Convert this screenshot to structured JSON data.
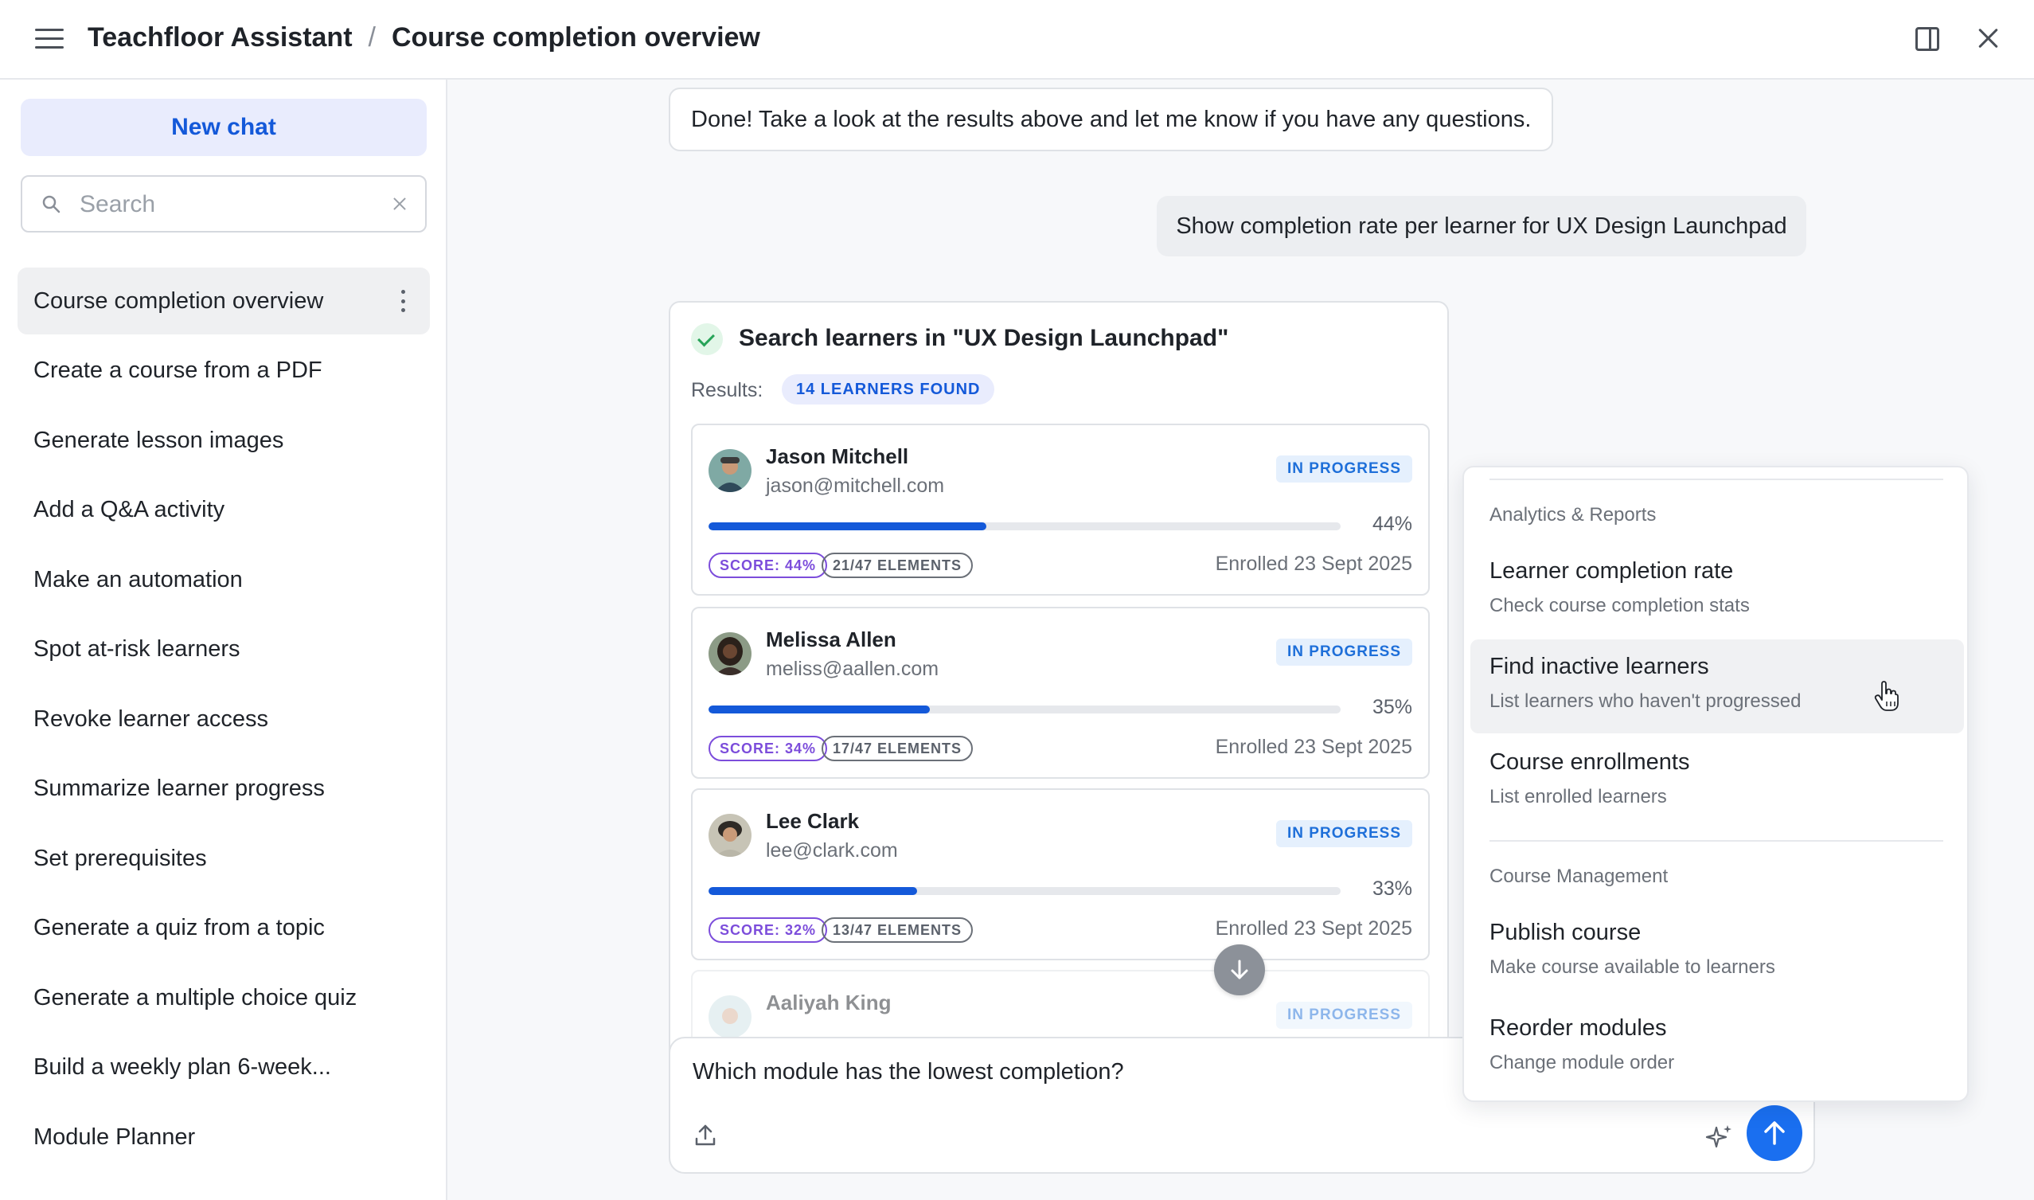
{
  "header": {
    "app_name": "Teachfloor Assistant",
    "separator": "/",
    "page_title": "Course completion overview"
  },
  "sidebar": {
    "new_chat_label": "New chat",
    "search_placeholder": "Search",
    "items": [
      {
        "label": "Course completion overview",
        "active": true
      },
      {
        "label": "Create a course from a PDF"
      },
      {
        "label": "Generate lesson images"
      },
      {
        "label": "Add a Q&A activity"
      },
      {
        "label": "Make an automation"
      },
      {
        "label": "Spot at-risk learners"
      },
      {
        "label": "Revoke learner access"
      },
      {
        "label": "Summarize learner progress"
      },
      {
        "label": "Set prerequisites"
      },
      {
        "label": "Generate a quiz from a topic"
      },
      {
        "label": "Generate a multiple choice quiz"
      },
      {
        "label": "Build a weekly plan 6-week..."
      },
      {
        "label": "Module Planner"
      }
    ]
  },
  "conversation": {
    "assistant_message": "Done! Take a look at the results above and let me know if you have any questions.",
    "user_message": "Show completion rate per learner for UX Design Launchpad"
  },
  "tool_result": {
    "title": "Search learners in \"UX Design Launchpad\"",
    "results_label": "Results:",
    "found_badge": "14 LEARNERS FOUND",
    "learners": [
      {
        "name": "Jason Mitchell",
        "email": "jason@mitchell.com",
        "status": "IN PROGRESS",
        "progress": 44,
        "progress_label": "44%",
        "score": "SCORE: 44%",
        "elements": "21/47 ELEMENTS",
        "enrolled": "Enrolled 23 Sept 2025"
      },
      {
        "name": "Melissa Allen",
        "email": "meliss@aallen.com",
        "status": "IN PROGRESS",
        "progress": 35,
        "progress_label": "35%",
        "score": "SCORE: 34%",
        "elements": "17/47 ELEMENTS",
        "enrolled": "Enrolled 23 Sept 2025"
      },
      {
        "name": "Lee Clark",
        "email": "lee@clark.com",
        "status": "IN PROGRESS",
        "progress": 33,
        "progress_label": "33%",
        "score": "SCORE: 32%",
        "elements": "13/47 ELEMENTS",
        "enrolled": "Enrolled 23 Sept 2025"
      },
      {
        "name": "Aaliyah King",
        "status": "IN PROGRESS"
      }
    ]
  },
  "composer": {
    "text": "Which module has the lowest completion?"
  },
  "dropdown": {
    "groups": [
      {
        "label": "Analytics & Reports",
        "items": [
          {
            "title": "Learner completion rate",
            "subtitle": "Check course completion stats"
          },
          {
            "title": "Find inactive learners",
            "subtitle": "List learners who haven't progressed",
            "hovered": true
          },
          {
            "title": "Course enrollments",
            "subtitle": "List enrolled learners"
          }
        ]
      },
      {
        "label": "Course Management",
        "items": [
          {
            "title": "Publish course",
            "subtitle": "Make course available to learners"
          },
          {
            "title": "Reorder modules",
            "subtitle": "Change module order"
          }
        ]
      }
    ]
  },
  "colors": {
    "accent": "#1459d9",
    "send_button": "#1a6ff0",
    "status_blue": "#1e6fd9",
    "score_purple": "#7c4ddb",
    "success_green": "#27a358"
  },
  "icons": [
    "menu-icon",
    "panel-toggle-icon",
    "close-icon",
    "search-icon",
    "clear-icon",
    "kebab-icon",
    "check-icon",
    "arrow-down-icon",
    "upload-icon",
    "sparkle-icon",
    "send-arrow-icon",
    "pointer-cursor-icon"
  ]
}
